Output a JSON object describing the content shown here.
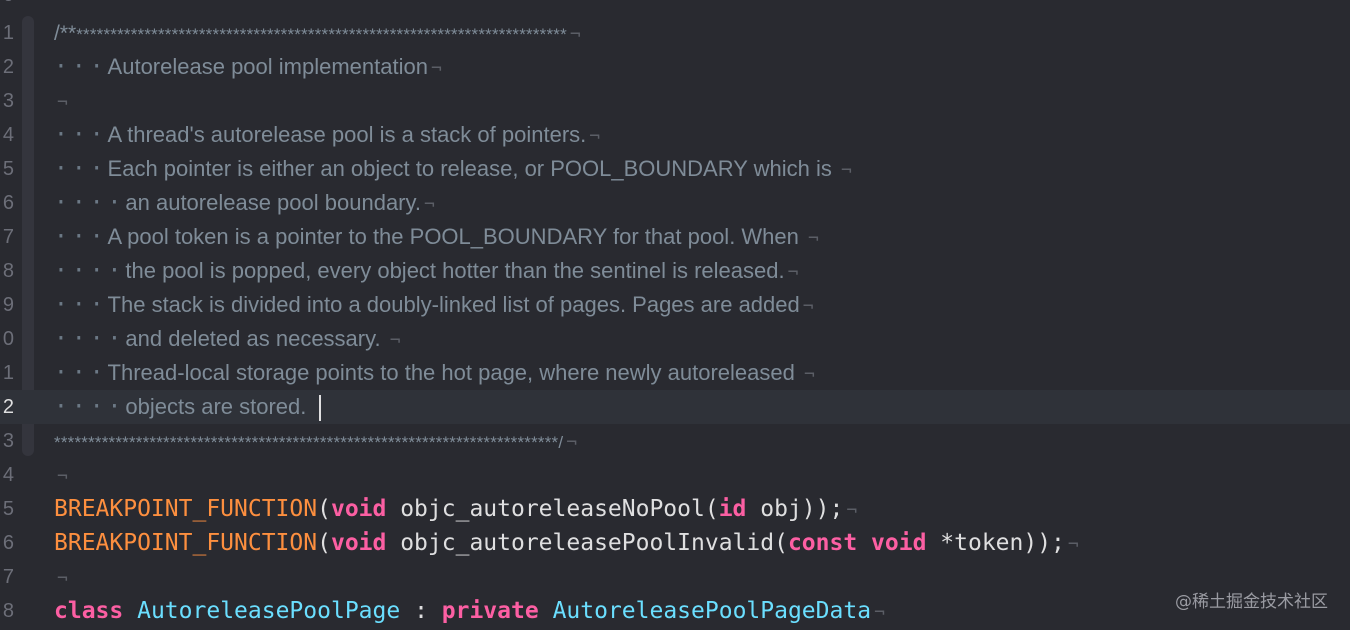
{
  "editor": {
    "top_line": {
      "num": "0"
    },
    "lines": [
      {
        "num": "1",
        "text": "/**************************************************************************"
      },
      {
        "num": "2",
        "text": "Autorelease pool implementation"
      },
      {
        "num": "3",
        "text": ""
      },
      {
        "num": "4",
        "text": "A thread's autorelease pool is a stack of pointers."
      },
      {
        "num": "5",
        "text": "Each pointer is either an object to release, or POOL_BOUNDARY which is "
      },
      {
        "num": "6",
        "text": "an autorelease pool boundary."
      },
      {
        "num": "7",
        "text": "A pool token is a pointer to the POOL_BOUNDARY for that pool. When "
      },
      {
        "num": "8",
        "text": "the pool is popped, every object hotter than the sentinel is released."
      },
      {
        "num": "9",
        "text": "The stack is divided into a doubly-linked list of pages. Pages are added"
      },
      {
        "num": "0",
        "text": "and deleted as necessary. "
      },
      {
        "num": "1",
        "text": "Thread-local storage points to the hot page, where newly autoreleased "
      },
      {
        "num": "2",
        "text": "objects are stored. "
      },
      {
        "num": "3",
        "text": "**************************************************************************/"
      },
      {
        "num": "4",
        "text": ""
      },
      {
        "num": "5",
        "macro": "BREAKPOINT_FUNCTION",
        "p1": "(",
        "kw1": "void",
        "p2": " objc_autoreleaseNoPool(",
        "kw2": "id",
        "p3": " obj));"
      },
      {
        "num": "6",
        "macro": "BREAKPOINT_FUNCTION",
        "p1": "(",
        "kw1": "void",
        "p2": " objc_autoreleasePoolInvalid(",
        "kw2": "const",
        "kw3": "void",
        "p3": " *token));"
      },
      {
        "num": "7",
        "text": ""
      },
      {
        "num": "8",
        "kw": "class",
        "type1": "AutoreleasePoolPage",
        "p1": " : ",
        "kw2": "private",
        "type2": "AutoreleasePoolPageData"
      }
    ],
    "newline_glyph": "¬",
    "indent_glyph": "·",
    "current_line": 12
  },
  "watermark": "@稀土掘金技术社区",
  "colors": {
    "background": "#292a30",
    "comment": "#7f8c98",
    "keyword": "#fc5fa3",
    "macro": "#fd8f3f",
    "type": "#6bdfff",
    "plain": "#dfdfe0"
  }
}
